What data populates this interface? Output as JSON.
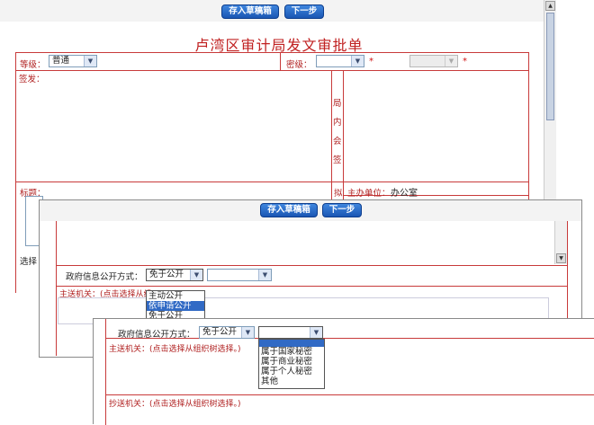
{
  "back": {
    "save_draft_label": "存入草稿箱",
    "next_label": "下一步",
    "form_title": "卢湾区审计局发文审批单",
    "grade_label": "等级：",
    "grade_value": "普通",
    "secret_label": "密级：",
    "required_mark": "*",
    "issuer_label": "签发：",
    "cosign_label": "局内会签",
    "subject_label": "标题：",
    "drafter_label": "拟",
    "host_unit_label": "主办单位：",
    "host_unit_value": "办公室",
    "select_label": "选择"
  },
  "middle": {
    "save_draft_label": "存入草稿箱",
    "next_label": "下一步",
    "disclosure_label": "政府信息公开方式：",
    "disclosure_value": "免于公开",
    "main_recipient_label": "主送机关：(点击选择从组",
    "options": [
      "主动公开",
      "依申请公开",
      "免于公开"
    ],
    "highlighted_option": 1
  },
  "front": {
    "disclosure_label": "政府信息公开方式：",
    "disclosure_value": "免于公开",
    "main_recipient_label": "主送机关：(点击选择从组织树选择。)",
    "cc_recipient_label": "抄送机关：(点击选择从组织树选择。)",
    "reason_options": [
      "",
      "属于国家秘密",
      "属于商业秘密",
      "属于个人秘密",
      "其他"
    ],
    "highlighted_option": 0
  },
  "colors": {
    "button_blue": "#1a56b3",
    "form_red": "#c83a3a",
    "highlight": "#316ac5"
  }
}
